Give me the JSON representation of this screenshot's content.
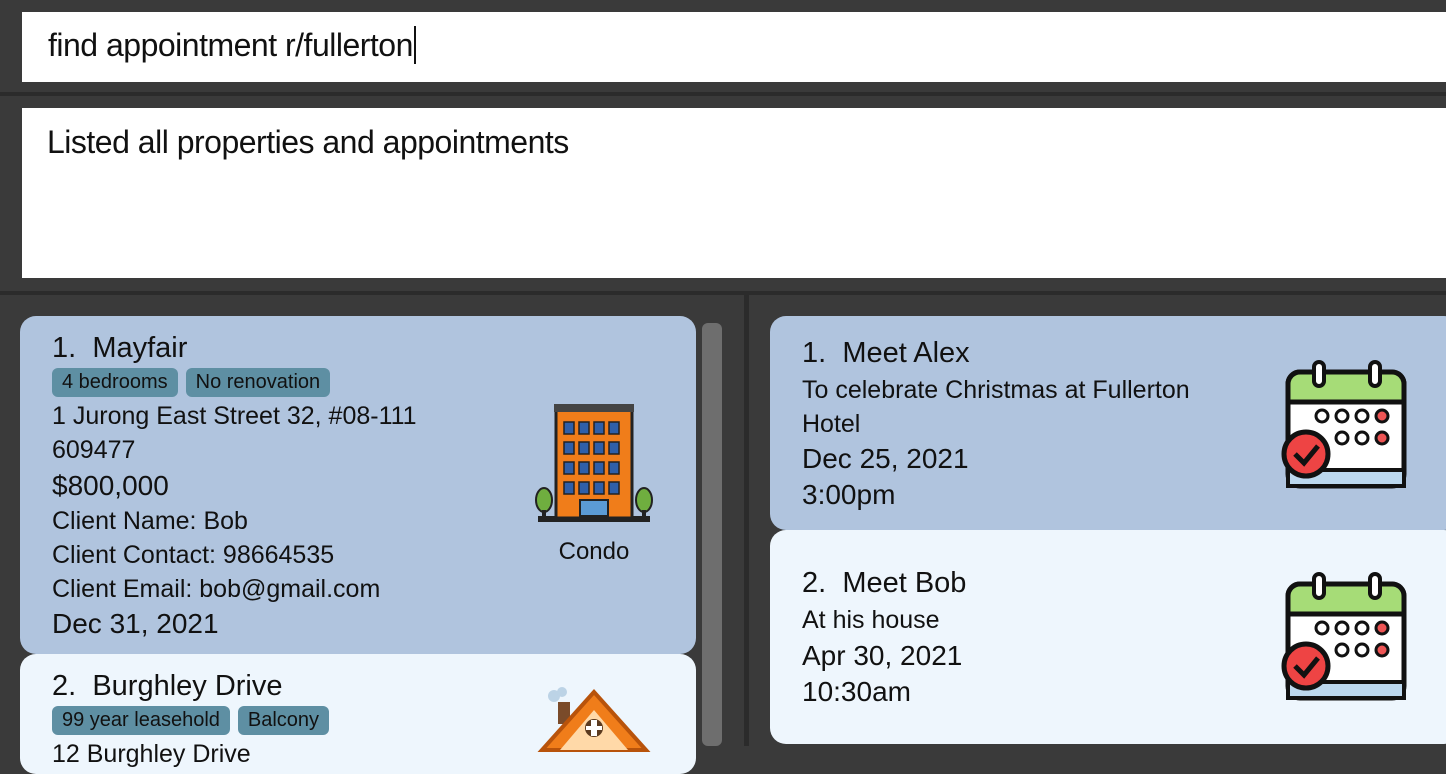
{
  "command_box": {
    "value": "find appointment r/fullerton"
  },
  "result_display": {
    "text": "Listed all properties and appointments"
  },
  "properties": [
    {
      "index": "1.",
      "name": "Mayfair",
      "tags": [
        "4 bedrooms",
        "No renovation"
      ],
      "address": "1 Jurong East Street 32, #08-111",
      "postal": "609477",
      "price": "$800,000",
      "client_name": "Client Name: Bob",
      "client_contact": "Client Contact: 98664535",
      "client_email": "Client Email: bob@gmail.com",
      "date": "Dec 31, 2021",
      "type": "Condo",
      "icon": "condo-building-icon"
    },
    {
      "index": "2.",
      "name": "Burghley Drive",
      "tags": [
        "99 year leasehold",
        "Balcony"
      ],
      "address": "12 Burghley Drive",
      "icon": "house-icon"
    }
  ],
  "appointments": [
    {
      "index": "1.",
      "title": "Meet Alex",
      "description_line1": "To celebrate Christmas at Fullerton",
      "description_line2": "Hotel",
      "date": "Dec 25, 2021",
      "time": "3:00pm",
      "icon": "calendar-icon"
    },
    {
      "index": "2.",
      "title": "Meet Bob",
      "description_line1": "At his house",
      "date": "Apr 30, 2021",
      "time": "10:30am",
      "icon": "calendar-icon"
    }
  ],
  "colors": {
    "card_selected": "#b0c4de",
    "card_default": "#eef6fd",
    "tag": "#5e8fa3",
    "background": "#3a3a3a"
  }
}
